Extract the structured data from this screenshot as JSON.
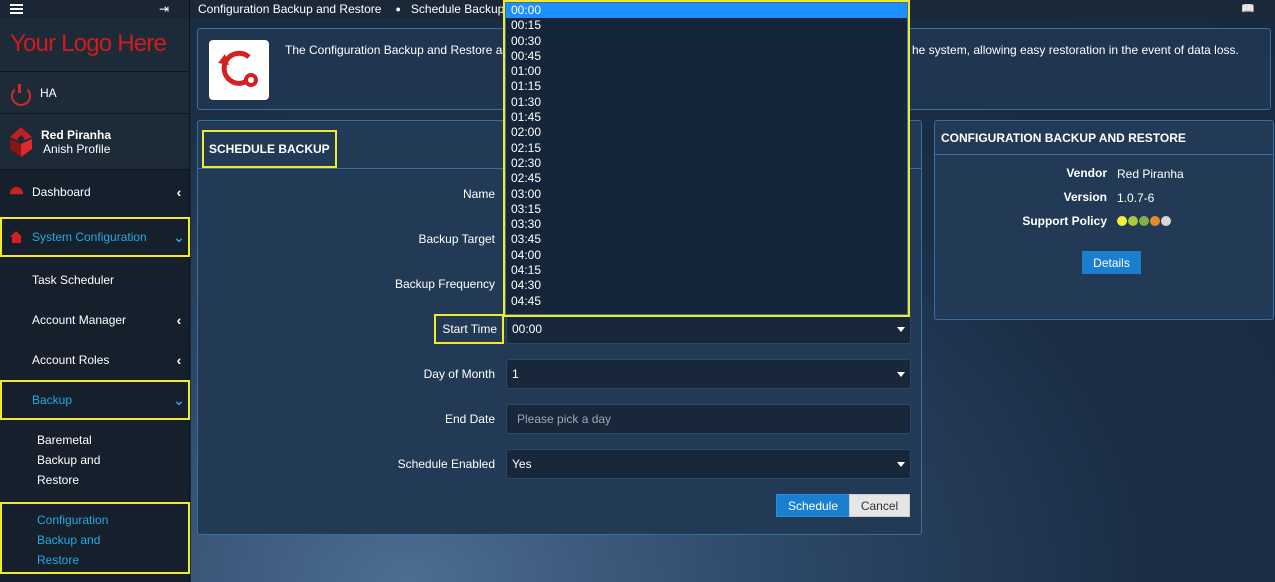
{
  "sidebar": {
    "logo": "Your Logo Here",
    "ha_label": "HA",
    "profile_name": "Red Piranha",
    "profile_sub": "Anish Profile",
    "items": [
      {
        "label": "Dashboard"
      },
      {
        "label": "System Configuration"
      },
      {
        "label": "Task Scheduler"
      },
      {
        "label": "Account Manager"
      },
      {
        "label": "Account Roles"
      },
      {
        "label": "Backup"
      },
      {
        "label_lines": [
          "Baremetal",
          "Backup and",
          "Restore"
        ]
      },
      {
        "label_lines": [
          "Configuration",
          "Backup and",
          "Restore"
        ]
      }
    ]
  },
  "breadcrumb": {
    "first": "Configuration Backup and Restore",
    "second": "Schedule Backup"
  },
  "info": {
    "text_left": "The Configuration Backup and Restore ap",
    "text_right": "he system, allowing easy restoration in the event of data loss."
  },
  "schedule": {
    "title": "SCHEDULE BACKUP",
    "fields": [
      {
        "label": "Name"
      },
      {
        "label": "Backup Target"
      },
      {
        "label": "Backup Frequency"
      },
      {
        "label": "Start Time",
        "value": "00:00"
      },
      {
        "label": "Day of Month",
        "value": "1"
      },
      {
        "label": "End Date",
        "placeholder": "Please pick a day"
      },
      {
        "label": "Schedule Enabled",
        "value": "Yes"
      }
    ],
    "schedule_button": "Schedule",
    "cancel_button": "Cancel"
  },
  "side_panel": {
    "title": "CONFIGURATION BACKUP AND RESTORE",
    "vendor_label": "Vendor",
    "vendor_value": "Red Piranha",
    "version_label": "Version",
    "version_value": "1.0.7-6",
    "support_label": "Support Policy",
    "support_dot_colors": [
      "#f4ee3a",
      "#a8c93a",
      "#82b04a",
      "#e88a2a",
      "#d8d8d8"
    ],
    "details_button": "Details"
  },
  "dropdown": {
    "selected": "00:00",
    "options": [
      "00:00",
      "00:15",
      "00:30",
      "00:45",
      "01:00",
      "01:15",
      "01:30",
      "01:45",
      "02:00",
      "02:15",
      "02:30",
      "02:45",
      "03:00",
      "03:15",
      "03:30",
      "03:45",
      "04:00",
      "04:15",
      "04:30",
      "04:45"
    ]
  },
  "colors": {
    "accent": "#29a8e0",
    "highlight": "#f2ea2c",
    "brand_red": "#d01c1c",
    "button_blue": "#1b7fd0"
  }
}
